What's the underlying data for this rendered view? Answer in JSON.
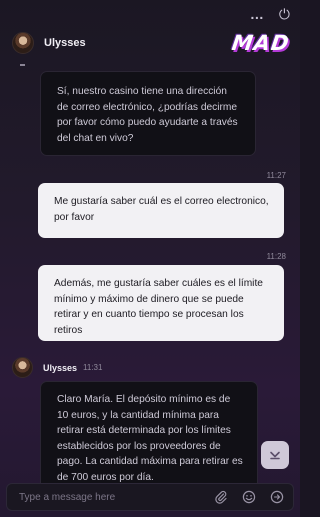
{
  "window": {
    "more_glyph": "…",
    "minimize_glyph": "⏻"
  },
  "header": {
    "agent_name": "Ulysses",
    "brand": "MAD"
  },
  "messages": [
    {
      "sender": "agent",
      "text": "Sí, nuestro casino tiene una dirección de correo electrónico, ¿podrías decirme por favor cómo puedo ayudarte a través del chat en vivo?"
    },
    {
      "sender": "user",
      "time": "11:27",
      "text": "Me gustaría saber cuál es el correo electronico, por favor"
    },
    {
      "sender": "user",
      "time": "11:28",
      "text": "Además, me gustaría saber cuáles es el límite mínimo y máximo de dinero que se puede retirar y en cuanto tiempo se procesan los retiros"
    },
    {
      "sender": "agent",
      "sender_name": "Ulysses",
      "time": "11:31",
      "text": "Claro María. El depósito mínimo es de 10 euros, y la cantidad mínima para retirar está determinada por los límites establecidos por los proveedores de pago. La cantidad máxima para retirar es de 700 euros por día."
    }
  ],
  "composer": {
    "placeholder": "Type a message here"
  },
  "colors": {
    "accent": "#b43ad8",
    "agent_bubble": "#111016",
    "user_bubble": "#f2f1f4"
  }
}
